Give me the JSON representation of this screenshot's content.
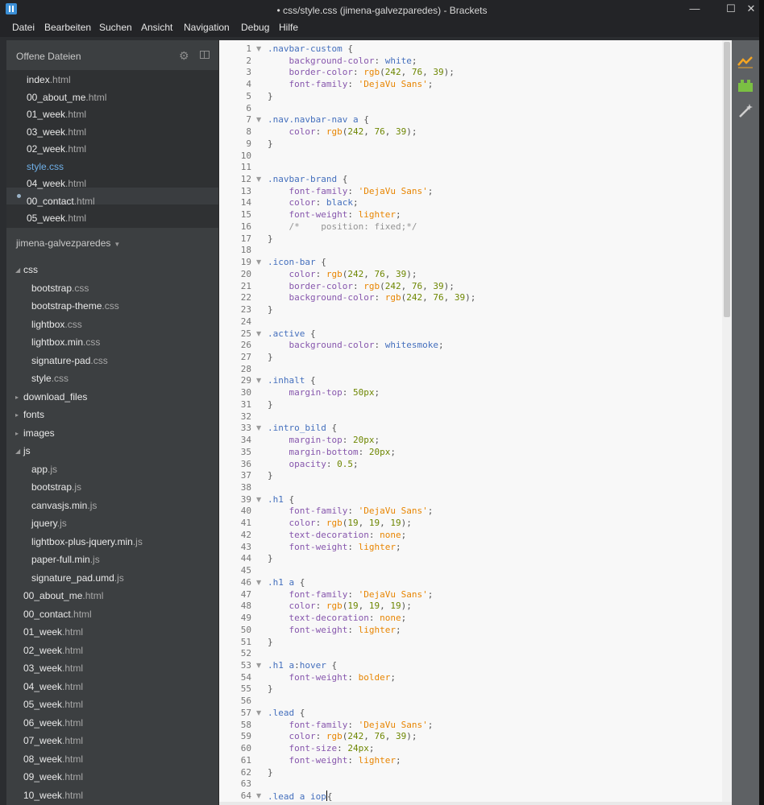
{
  "window": {
    "title": "• css/style.css (jimena-galvezparedes) - Brackets",
    "minimize": "—",
    "maximize": "☐",
    "close": "✕"
  },
  "menu": [
    "Datei",
    "Bearbeiten",
    "Suchen",
    "Ansicht",
    "Navigation",
    "Debug",
    "Hilfe"
  ],
  "sidebar": {
    "working_files_title": "Offene Dateien",
    "working_files": [
      {
        "name": "index",
        "ext": ".html"
      },
      {
        "name": "00_about_me",
        "ext": ".html"
      },
      {
        "name": "01_week",
        "ext": ".html"
      },
      {
        "name": "03_week",
        "ext": ".html"
      },
      {
        "name": "02_week",
        "ext": ".html"
      },
      {
        "name": "style",
        "ext": ".css",
        "active": true
      },
      {
        "name": "04_week",
        "ext": ".html"
      },
      {
        "name": "00_contact",
        "ext": ".html"
      },
      {
        "name": "05_week",
        "ext": ".html"
      }
    ],
    "project_title": "jimena-galvezparedes",
    "tree": [
      {
        "type": "folder",
        "name": "css",
        "open": true,
        "level": 0
      },
      {
        "type": "file",
        "name": "bootstrap",
        "ext": ".css",
        "level": 1
      },
      {
        "type": "file",
        "name": "bootstrap-theme",
        "ext": ".css",
        "level": 1
      },
      {
        "type": "file",
        "name": "lightbox",
        "ext": ".css",
        "level": 1
      },
      {
        "type": "file",
        "name": "lightbox.min",
        "ext": ".css",
        "level": 1
      },
      {
        "type": "file",
        "name": "signature-pad",
        "ext": ".css",
        "level": 1
      },
      {
        "type": "file",
        "name": "style",
        "ext": ".css",
        "level": 1
      },
      {
        "type": "folder",
        "name": "download_files",
        "open": false,
        "level": 0
      },
      {
        "type": "folder",
        "name": "fonts",
        "open": false,
        "level": 0
      },
      {
        "type": "folder",
        "name": "images",
        "open": false,
        "level": 0
      },
      {
        "type": "folder",
        "name": "js",
        "open": true,
        "level": 0
      },
      {
        "type": "file",
        "name": "app",
        "ext": ".js",
        "level": 1
      },
      {
        "type": "file",
        "name": "bootstrap",
        "ext": ".js",
        "level": 1
      },
      {
        "type": "file",
        "name": "canvasjs.min",
        "ext": ".js",
        "level": 1
      },
      {
        "type": "file",
        "name": "jquery",
        "ext": ".js",
        "level": 1
      },
      {
        "type": "file",
        "name": "lightbox-plus-jquery.min",
        "ext": ".js",
        "level": 1
      },
      {
        "type": "file",
        "name": "paper-full.min",
        "ext": ".js",
        "level": 1
      },
      {
        "type": "file",
        "name": "signature_pad.umd",
        "ext": ".js",
        "level": 1
      },
      {
        "type": "file",
        "name": "00_about_me",
        "ext": ".html",
        "level": 0
      },
      {
        "type": "file",
        "name": "00_contact",
        "ext": ".html",
        "level": 0
      },
      {
        "type": "file",
        "name": "01_week",
        "ext": ".html",
        "level": 0
      },
      {
        "type": "file",
        "name": "02_week",
        "ext": ".html",
        "level": 0
      },
      {
        "type": "file",
        "name": "03_week",
        "ext": ".html",
        "level": 0
      },
      {
        "type": "file",
        "name": "04_week",
        "ext": ".html",
        "level": 0
      },
      {
        "type": "file",
        "name": "05_week",
        "ext": ".html",
        "level": 0
      },
      {
        "type": "file",
        "name": "06_week",
        "ext": ".html",
        "level": 0
      },
      {
        "type": "file",
        "name": "07_week",
        "ext": ".html",
        "level": 0
      },
      {
        "type": "file",
        "name": "08_week",
        "ext": ".html",
        "level": 0
      },
      {
        "type": "file",
        "name": "09_week",
        "ext": ".html",
        "level": 0
      },
      {
        "type": "file",
        "name": "10_week",
        "ext": ".html",
        "level": 0
      }
    ]
  },
  "editor": {
    "fold_lines": [
      1,
      7,
      12,
      19,
      25,
      29,
      33,
      39,
      46,
      53,
      57,
      64
    ],
    "cursor_line": 64,
    "lines": [
      [
        [
          "sel",
          ".navbar-custom"
        ],
        [
          "pun",
          " {"
        ]
      ],
      [
        [
          "pun",
          "    "
        ],
        [
          "prop",
          "background-color"
        ],
        [
          "pun",
          ": "
        ],
        [
          "sel",
          "white"
        ],
        [
          "pun",
          ";"
        ]
      ],
      [
        [
          "pun",
          "    "
        ],
        [
          "prop",
          "border-color"
        ],
        [
          "pun",
          ": "
        ],
        [
          "str",
          "rgb"
        ],
        [
          "pun",
          "("
        ],
        [
          "num",
          "242"
        ],
        [
          "pun",
          ", "
        ],
        [
          "num",
          "76"
        ],
        [
          "pun",
          ", "
        ],
        [
          "num",
          "39"
        ],
        [
          "pun",
          ");"
        ]
      ],
      [
        [
          "pun",
          "    "
        ],
        [
          "prop",
          "font-family"
        ],
        [
          "pun",
          ": "
        ],
        [
          "str",
          "'DejaVu Sans'"
        ],
        [
          "pun",
          ";"
        ]
      ],
      [
        [
          "pun",
          "}"
        ]
      ],
      [
        [
          "pun",
          ""
        ]
      ],
      [
        [
          "sel",
          ".nav.navbar-nav a"
        ],
        [
          "pun",
          " {"
        ]
      ],
      [
        [
          "pun",
          "    "
        ],
        [
          "prop",
          "color"
        ],
        [
          "pun",
          ": "
        ],
        [
          "str",
          "rgb"
        ],
        [
          "pun",
          "("
        ],
        [
          "num",
          "242"
        ],
        [
          "pun",
          ", "
        ],
        [
          "num",
          "76"
        ],
        [
          "pun",
          ", "
        ],
        [
          "num",
          "39"
        ],
        [
          "pun",
          ");"
        ]
      ],
      [
        [
          "pun",
          "}"
        ]
      ],
      [
        [
          "pun",
          ""
        ]
      ],
      [
        [
          "pun",
          ""
        ]
      ],
      [
        [
          "sel",
          ".navbar-brand"
        ],
        [
          "pun",
          " {"
        ]
      ],
      [
        [
          "pun",
          "    "
        ],
        [
          "prop",
          "font-family"
        ],
        [
          "pun",
          ": "
        ],
        [
          "str",
          "'DejaVu Sans'"
        ],
        [
          "pun",
          ";"
        ]
      ],
      [
        [
          "pun",
          "    "
        ],
        [
          "prop",
          "color"
        ],
        [
          "pun",
          ": "
        ],
        [
          "sel",
          "black"
        ],
        [
          "pun",
          ";"
        ]
      ],
      [
        [
          "pun",
          "    "
        ],
        [
          "prop",
          "font-weight"
        ],
        [
          "pun",
          ": "
        ],
        [
          "str",
          "lighter"
        ],
        [
          "pun",
          ";"
        ]
      ],
      [
        [
          "pun",
          "    "
        ],
        [
          "com",
          "/*    position: fixed;*/"
        ]
      ],
      [
        [
          "pun",
          "}"
        ]
      ],
      [
        [
          "pun",
          ""
        ]
      ],
      [
        [
          "sel",
          ".icon-bar"
        ],
        [
          "pun",
          " {"
        ]
      ],
      [
        [
          "pun",
          "    "
        ],
        [
          "prop",
          "color"
        ],
        [
          "pun",
          ": "
        ],
        [
          "str",
          "rgb"
        ],
        [
          "pun",
          "("
        ],
        [
          "num",
          "242"
        ],
        [
          "pun",
          ", "
        ],
        [
          "num",
          "76"
        ],
        [
          "pun",
          ", "
        ],
        [
          "num",
          "39"
        ],
        [
          "pun",
          ");"
        ]
      ],
      [
        [
          "pun",
          "    "
        ],
        [
          "prop",
          "border-color"
        ],
        [
          "pun",
          ": "
        ],
        [
          "str",
          "rgb"
        ],
        [
          "pun",
          "("
        ],
        [
          "num",
          "242"
        ],
        [
          "pun",
          ", "
        ],
        [
          "num",
          "76"
        ],
        [
          "pun",
          ", "
        ],
        [
          "num",
          "39"
        ],
        [
          "pun",
          ");"
        ]
      ],
      [
        [
          "pun",
          "    "
        ],
        [
          "prop",
          "background-color"
        ],
        [
          "pun",
          ": "
        ],
        [
          "str",
          "rgb"
        ],
        [
          "pun",
          "("
        ],
        [
          "num",
          "242"
        ],
        [
          "pun",
          ", "
        ],
        [
          "num",
          "76"
        ],
        [
          "pun",
          ", "
        ],
        [
          "num",
          "39"
        ],
        [
          "pun",
          ");"
        ]
      ],
      [
        [
          "pun",
          "}"
        ]
      ],
      [
        [
          "pun",
          ""
        ]
      ],
      [
        [
          "sel",
          ".active"
        ],
        [
          "pun",
          " {"
        ]
      ],
      [
        [
          "pun",
          "    "
        ],
        [
          "prop",
          "background-color"
        ],
        [
          "pun",
          ": "
        ],
        [
          "sel",
          "whitesmoke"
        ],
        [
          "pun",
          ";"
        ]
      ],
      [
        [
          "pun",
          "}"
        ]
      ],
      [
        [
          "pun",
          ""
        ]
      ],
      [
        [
          "sel",
          ".inhalt"
        ],
        [
          "pun",
          " {"
        ]
      ],
      [
        [
          "pun",
          "    "
        ],
        [
          "prop",
          "margin-top"
        ],
        [
          "pun",
          ": "
        ],
        [
          "num",
          "50px"
        ],
        [
          "pun",
          ";"
        ]
      ],
      [
        [
          "pun",
          "}"
        ]
      ],
      [
        [
          "pun",
          ""
        ]
      ],
      [
        [
          "sel",
          ".intro_bild"
        ],
        [
          "pun",
          " {"
        ]
      ],
      [
        [
          "pun",
          "    "
        ],
        [
          "prop",
          "margin-top"
        ],
        [
          "pun",
          ": "
        ],
        [
          "num",
          "20px"
        ],
        [
          "pun",
          ";"
        ]
      ],
      [
        [
          "pun",
          "    "
        ],
        [
          "prop",
          "margin-bottom"
        ],
        [
          "pun",
          ": "
        ],
        [
          "num",
          "20px"
        ],
        [
          "pun",
          ";"
        ]
      ],
      [
        [
          "pun",
          "    "
        ],
        [
          "prop",
          "opacity"
        ],
        [
          "pun",
          ": "
        ],
        [
          "num",
          "0.5"
        ],
        [
          "pun",
          ";"
        ]
      ],
      [
        [
          "pun",
          "}"
        ]
      ],
      [
        [
          "pun",
          ""
        ]
      ],
      [
        [
          "sel",
          ".h1"
        ],
        [
          "pun",
          " {"
        ]
      ],
      [
        [
          "pun",
          "    "
        ],
        [
          "prop",
          "font-family"
        ],
        [
          "pun",
          ": "
        ],
        [
          "str",
          "'DejaVu Sans'"
        ],
        [
          "pun",
          ";"
        ]
      ],
      [
        [
          "pun",
          "    "
        ],
        [
          "prop",
          "color"
        ],
        [
          "pun",
          ": "
        ],
        [
          "str",
          "rgb"
        ],
        [
          "pun",
          "("
        ],
        [
          "num",
          "19"
        ],
        [
          "pun",
          ", "
        ],
        [
          "num",
          "19"
        ],
        [
          "pun",
          ", "
        ],
        [
          "num",
          "19"
        ],
        [
          "pun",
          ");"
        ]
      ],
      [
        [
          "pun",
          "    "
        ],
        [
          "prop",
          "text-decoration"
        ],
        [
          "pun",
          ": "
        ],
        [
          "str",
          "none"
        ],
        [
          "pun",
          ";"
        ]
      ],
      [
        [
          "pun",
          "    "
        ],
        [
          "prop",
          "font-weight"
        ],
        [
          "pun",
          ": "
        ],
        [
          "str",
          "lighter"
        ],
        [
          "pun",
          ";"
        ]
      ],
      [
        [
          "pun",
          "}"
        ]
      ],
      [
        [
          "pun",
          ""
        ]
      ],
      [
        [
          "sel",
          ".h1 a"
        ],
        [
          "pun",
          " {"
        ]
      ],
      [
        [
          "pun",
          "    "
        ],
        [
          "prop",
          "font-family"
        ],
        [
          "pun",
          ": "
        ],
        [
          "str",
          "'DejaVu Sans'"
        ],
        [
          "pun",
          ";"
        ]
      ],
      [
        [
          "pun",
          "    "
        ],
        [
          "prop",
          "color"
        ],
        [
          "pun",
          ": "
        ],
        [
          "str",
          "rgb"
        ],
        [
          "pun",
          "("
        ],
        [
          "num",
          "19"
        ],
        [
          "pun",
          ", "
        ],
        [
          "num",
          "19"
        ],
        [
          "pun",
          ", "
        ],
        [
          "num",
          "19"
        ],
        [
          "pun",
          ");"
        ]
      ],
      [
        [
          "pun",
          "    "
        ],
        [
          "prop",
          "text-decoration"
        ],
        [
          "pun",
          ": "
        ],
        [
          "str",
          "none"
        ],
        [
          "pun",
          ";"
        ]
      ],
      [
        [
          "pun",
          "    "
        ],
        [
          "prop",
          "font-weight"
        ],
        [
          "pun",
          ": "
        ],
        [
          "str",
          "lighter"
        ],
        [
          "pun",
          ";"
        ]
      ],
      [
        [
          "pun",
          "}"
        ]
      ],
      [
        [
          "pun",
          ""
        ]
      ],
      [
        [
          "sel",
          ".h1 a"
        ],
        [
          "pun",
          ":"
        ],
        [
          "sel",
          "hover"
        ],
        [
          "pun",
          " {"
        ]
      ],
      [
        [
          "pun",
          "    "
        ],
        [
          "prop",
          "font-weight"
        ],
        [
          "pun",
          ": "
        ],
        [
          "str",
          "bolder"
        ],
        [
          "pun",
          ";"
        ]
      ],
      [
        [
          "pun",
          "}"
        ]
      ],
      [
        [
          "pun",
          ""
        ]
      ],
      [
        [
          "sel",
          ".lead"
        ],
        [
          "pun",
          " {"
        ]
      ],
      [
        [
          "pun",
          "    "
        ],
        [
          "prop",
          "font-family"
        ],
        [
          "pun",
          ": "
        ],
        [
          "str",
          "'DejaVu Sans'"
        ],
        [
          "pun",
          ";"
        ]
      ],
      [
        [
          "pun",
          "    "
        ],
        [
          "prop",
          "color"
        ],
        [
          "pun",
          ": "
        ],
        [
          "str",
          "rgb"
        ],
        [
          "pun",
          "("
        ],
        [
          "num",
          "242"
        ],
        [
          "pun",
          ", "
        ],
        [
          "num",
          "76"
        ],
        [
          "pun",
          ", "
        ],
        [
          "num",
          "39"
        ],
        [
          "pun",
          ");"
        ]
      ],
      [
        [
          "pun",
          "    "
        ],
        [
          "prop",
          "font-size"
        ],
        [
          "pun",
          ": "
        ],
        [
          "num",
          "24px"
        ],
        [
          "pun",
          ";"
        ]
      ],
      [
        [
          "pun",
          "    "
        ],
        [
          "prop",
          "font-weight"
        ],
        [
          "pun",
          ": "
        ],
        [
          "str",
          "lighter"
        ],
        [
          "pun",
          ";"
        ]
      ],
      [
        [
          "pun",
          "}"
        ]
      ],
      [
        [
          "pun",
          ""
        ]
      ],
      [
        [
          "sel",
          ".lead a iop"
        ],
        [
          "pun",
          "{"
        ]
      ]
    ]
  },
  "toolbar_icons": [
    "live-preview-icon",
    "extension-manager-icon",
    "beautify-wand-icon"
  ],
  "colors": {
    "accent_blue": "#6fb0e8",
    "live_preview": "#f5a623",
    "extension_green": "#7bc043"
  }
}
